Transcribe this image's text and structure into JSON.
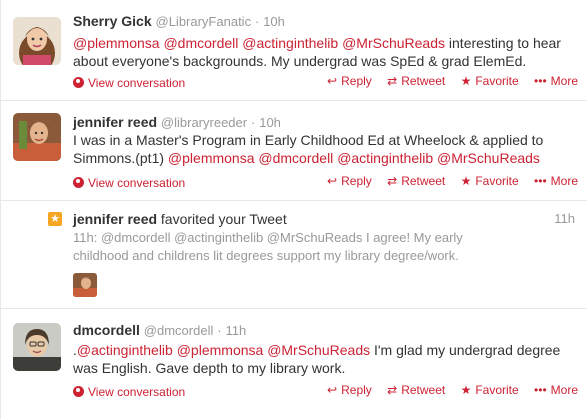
{
  "tweets": [
    {
      "fullname": "Sherry Gick",
      "handle": "@LibraryFanatic",
      "time": "10h",
      "text_parts": [
        {
          "t": "@plemmonsa",
          "m": true
        },
        {
          "t": " ",
          "m": false
        },
        {
          "t": "@dmcordell",
          "m": true
        },
        {
          "t": " ",
          "m": false
        },
        {
          "t": "@actinginthelib",
          "m": true
        },
        {
          "t": " ",
          "m": false
        },
        {
          "t": "@MrSchuReads",
          "m": true
        },
        {
          "t": " interesting to hear about everyone's backgrounds. My undergrad was SpEd & grad ElemEd.",
          "m": false
        }
      ],
      "view_conversation": "View conversation"
    },
    {
      "fullname": "jennifer reed",
      "handle": "@libraryreeder",
      "time": "10h",
      "text_parts": [
        {
          "t": "I was in a Master's Program in Early Childhood Ed at Wheelock & applied to Simmons.(pt1) ",
          "m": false
        },
        {
          "t": "@plemmonsa",
          "m": true
        },
        {
          "t": " ",
          "m": false
        },
        {
          "t": "@dmcordell",
          "m": true
        },
        {
          "t": " ",
          "m": false
        },
        {
          "t": "@actinginthelib",
          "m": true
        },
        {
          "t": " ",
          "m": false
        },
        {
          "t": "@MrSchuReads",
          "m": true
        }
      ],
      "view_conversation": "View conversation"
    },
    {
      "fullname": "dmcordell",
      "handle": "@dmcordell",
      "time": "11h",
      "text_parts": [
        {
          "t": ".",
          "m": false
        },
        {
          "t": "@actinginthelib",
          "m": true
        },
        {
          "t": " ",
          "m": false
        },
        {
          "t": "@plemmonsa",
          "m": true
        },
        {
          "t": " ",
          "m": false
        },
        {
          "t": "@MrSchuReads",
          "m": true
        },
        {
          "t": " I'm glad my undergrad degree was English. Gave depth to my library work.",
          "m": false
        }
      ],
      "view_conversation": "View conversation"
    }
  ],
  "notification": {
    "fullname": "jennifer reed",
    "verb": "favorited your Tweet",
    "time": "11h",
    "quoted_text": "11h: @dmcordell @actinginthelib @MrSchuReads I agree!  My early childhood and childrens lit degrees support my library degree/work.",
    "icon": "star-icon"
  },
  "actions": {
    "reply": "Reply",
    "retweet": "Retweet",
    "favorite": "Favorite",
    "more": "More"
  },
  "separator": "·",
  "colors": {
    "accent": "#cc2233",
    "muted": "#999999",
    "text": "#333333",
    "notif_star": "#f5a623"
  }
}
